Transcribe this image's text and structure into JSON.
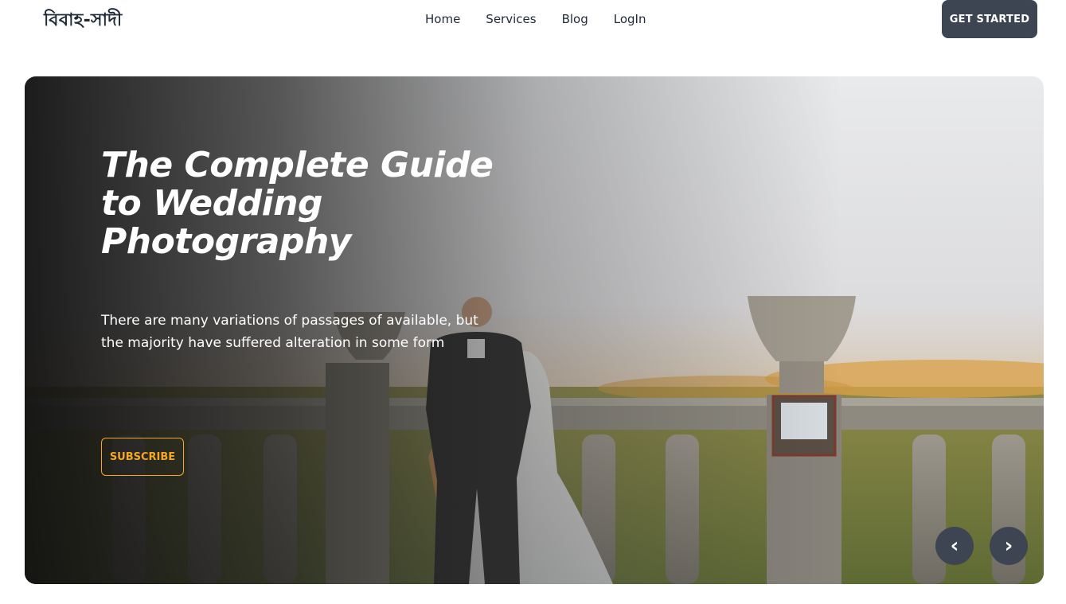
{
  "brand": {
    "logo": "বিবাহ-সাদী"
  },
  "nav": {
    "items": [
      {
        "label": "Home"
      },
      {
        "label": "Services"
      },
      {
        "label": "Blog"
      },
      {
        "label": "LogIn"
      }
    ],
    "cta_label": "GET STARTED"
  },
  "hero": {
    "title": "The Complete Guide to Wedding Photography",
    "description": "There are many variations of passages of available, but the majority have suffered alteration in some form",
    "subscribe_label": "SUBSCRIBE",
    "prev_icon": "chevron-left-icon",
    "next_icon": "chevron-right-icon",
    "prev_glyph": "‹",
    "next_glyph": "›"
  },
  "colors": {
    "accent": "#f5a623",
    "button_dark": "#3d4452",
    "text_dark": "#1f2a37"
  }
}
